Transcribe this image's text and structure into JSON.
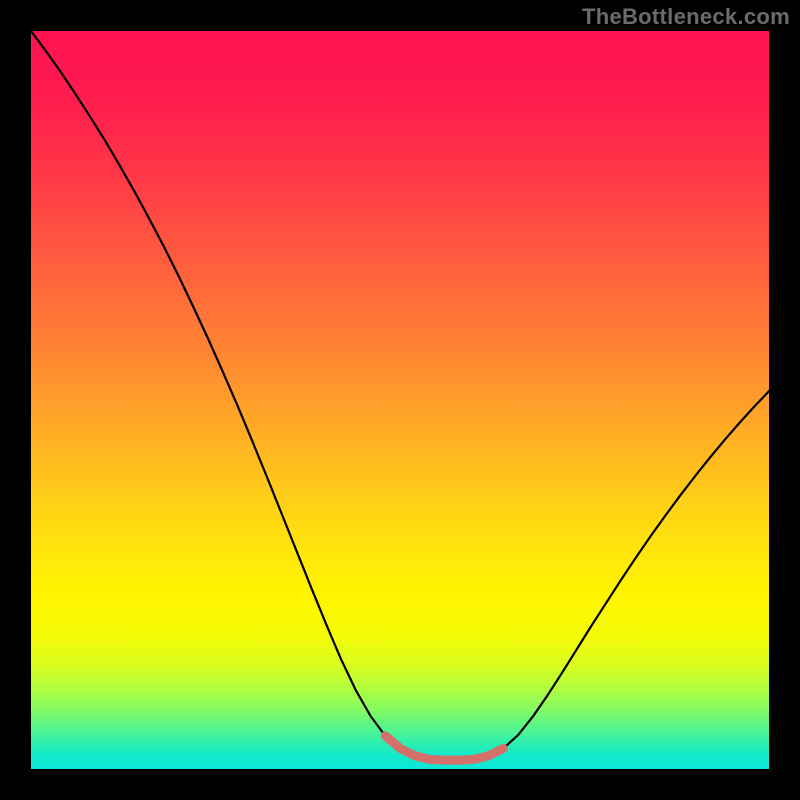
{
  "watermark": "TheBottleneck.com",
  "colors": {
    "background": "#000000",
    "watermark_text": "#6b6b6b",
    "curve_stroke": "#000000",
    "flat_segment_stroke": "#d46f6a",
    "gradient_stops": [
      "#ff1251",
      "#ff1a4f",
      "#ff3348",
      "#ff5940",
      "#ff8034",
      "#ffa428",
      "#ffc91a",
      "#ffe40c",
      "#fff600",
      "#f4fb06",
      "#d9fd20",
      "#b3fd3e",
      "#83fb63",
      "#54f58d",
      "#2eefb0",
      "#14eac9",
      "#0ae8d6"
    ]
  },
  "chart_data": {
    "type": "line",
    "title": "",
    "xlabel": "",
    "ylabel": "",
    "xlim": [
      0,
      100
    ],
    "ylim": [
      0,
      100
    ],
    "grid": false,
    "legend": false,
    "x": [
      0,
      2,
      4,
      6,
      8,
      10,
      12,
      14,
      16,
      18,
      20,
      22,
      24,
      26,
      28,
      30,
      32,
      34,
      36,
      38,
      40,
      42,
      44,
      46,
      48,
      50,
      52,
      54,
      56,
      58,
      60,
      62,
      64,
      66,
      68,
      70,
      72,
      74,
      76,
      78,
      80,
      82,
      84,
      86,
      88,
      90,
      92,
      94,
      96,
      98,
      100
    ],
    "series": [
      {
        "name": "curve",
        "stroke": "#000000",
        "values": [
          100,
          97.3,
          94.5,
          91.5,
          88.4,
          85.2,
          81.8,
          78.3,
          74.6,
          70.8,
          66.8,
          62.6,
          58.3,
          53.8,
          49.2,
          44.4,
          39.5,
          34.5,
          29.5,
          24.5,
          19.6,
          14.9,
          10.7,
          7.2,
          4.5,
          2.8,
          1.8,
          1.3,
          1.2,
          1.2,
          1.3,
          1.8,
          2.8,
          4.6,
          7.1,
          10.0,
          13.1,
          16.3,
          19.5,
          22.6,
          25.7,
          28.7,
          31.6,
          34.4,
          37.1,
          39.7,
          42.2,
          44.6,
          46.9,
          49.1,
          51.2
        ]
      },
      {
        "name": "flat-segment",
        "stroke": "#d46f6a",
        "values": [
          null,
          null,
          null,
          null,
          null,
          null,
          null,
          null,
          null,
          null,
          null,
          null,
          null,
          null,
          null,
          null,
          null,
          null,
          null,
          null,
          null,
          null,
          null,
          null,
          4.5,
          2.8,
          1.8,
          1.3,
          1.2,
          1.2,
          1.3,
          1.8,
          2.8,
          null,
          null,
          null,
          null,
          null,
          null,
          null,
          null,
          null,
          null,
          null,
          null,
          null,
          null,
          null,
          null,
          null,
          null
        ]
      }
    ]
  }
}
